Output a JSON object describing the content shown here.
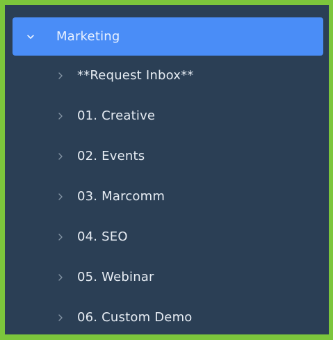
{
  "sidebar": {
    "parent": {
      "label": "Marketing",
      "icon": "chevron-down-icon"
    },
    "children": [
      {
        "label": "**Request Inbox**",
        "icon": "chevron-right-icon"
      },
      {
        "label": "01. Creative",
        "icon": "chevron-right-icon"
      },
      {
        "label": "02. Events",
        "icon": "chevron-right-icon"
      },
      {
        "label": "03. Marcomm",
        "icon": "chevron-right-icon"
      },
      {
        "label": "04. SEO",
        "icon": "chevron-right-icon"
      },
      {
        "label": "05. Webinar",
        "icon": "chevron-right-icon"
      },
      {
        "label": "06. Custom Demo",
        "icon": "chevron-right-icon"
      }
    ]
  },
  "colors": {
    "frame": "#7cc63c",
    "panel": "#2b3f55",
    "selected": "#4a8df7"
  }
}
